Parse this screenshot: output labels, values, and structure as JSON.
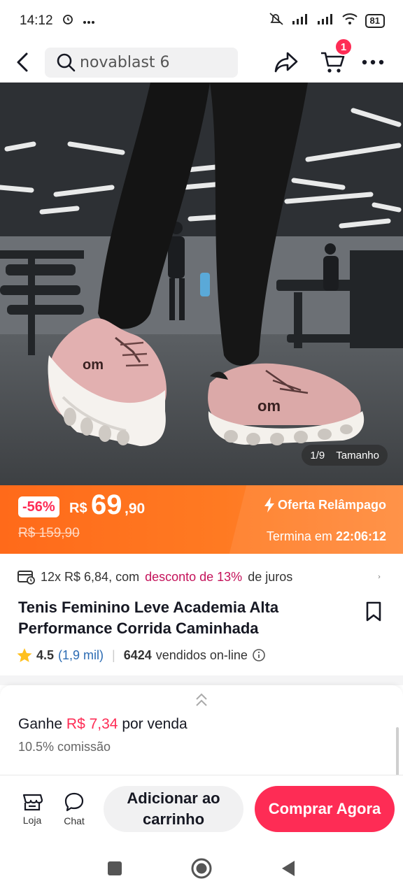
{
  "status_bar": {
    "time": "14:12",
    "battery": "81"
  },
  "nav": {
    "search_text": "novablast 6",
    "cart_count": "1"
  },
  "gallery": {
    "counter": "1/9",
    "size_label": "Tamanho"
  },
  "flash_sale": {
    "discount": "-56%",
    "currency": "R$",
    "price_int": "69",
    "price_dec": ",90",
    "old_price": "R$ 159,90",
    "label": "Oferta Relâmpago",
    "timer_prefix": "Termina em",
    "timer": "22:06:12"
  },
  "installments": {
    "text": "12x R$ 6,84, com",
    "highlight": "desconto de 13%",
    "suffix": "de juros"
  },
  "product": {
    "title": "Tenis Feminino Leve Academia Alta Performance Corrida Caminhada",
    "rating": "4.5",
    "rating_count": "(1,9 mil)",
    "sold": "6424",
    "sold_label": "vendidos on-line"
  },
  "commission": {
    "earn_prefix": "Ganhe",
    "earn_amount": "R$ 7,34",
    "earn_suffix": "por venda",
    "rate": "10.5% comissão"
  },
  "actions": {
    "store": "Loja",
    "chat": "Chat",
    "add_to_cart": "Adicionar ao carrinho",
    "buy_now": "Comprar Agora"
  },
  "colors": {
    "brand": "#fe2c55",
    "flash_orange": "#ff6a1a",
    "link_blue": "#2b6bb3",
    "highlight_magenta": "#c4125a"
  }
}
